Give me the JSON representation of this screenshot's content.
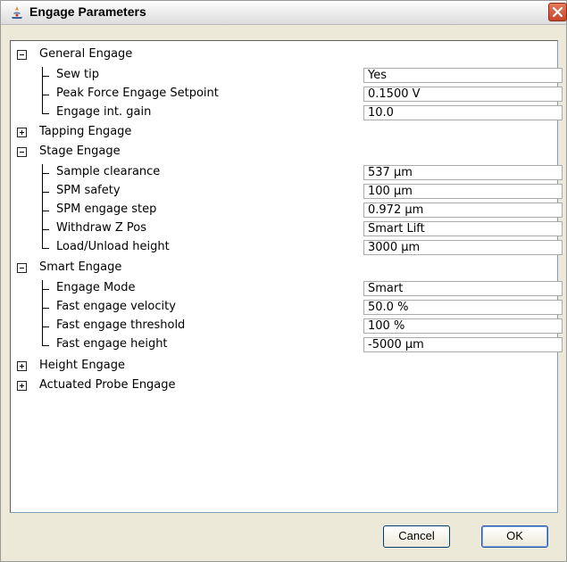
{
  "window": {
    "title": "Engage Parameters",
    "icon": "app-icon",
    "close_icon": "close-icon"
  },
  "groups": [
    {
      "label": "General Engage",
      "expanded": true,
      "items": [
        {
          "label": "Sew tip",
          "value": "Yes"
        },
        {
          "label": "Peak Force Engage Setpoint",
          "value": "0.1500 V"
        },
        {
          "label": "Engage int. gain",
          "value": "10.0"
        }
      ]
    },
    {
      "label": "Tapping Engage",
      "expanded": false,
      "items": []
    },
    {
      "label": "Stage Engage",
      "expanded": true,
      "items": [
        {
          "label": "Sample clearance",
          "value": "537 µm"
        },
        {
          "label": "SPM safety",
          "value": "100 µm"
        },
        {
          "label": "SPM engage step",
          "value": "0.972 µm"
        },
        {
          "label": "Withdraw Z Pos",
          "value": "Smart Lift"
        },
        {
          "label": "Load/Unload height",
          "value": "3000 µm"
        }
      ]
    },
    {
      "label": "Smart Engage",
      "expanded": true,
      "items": [
        {
          "label": "Engage Mode",
          "value": "Smart"
        },
        {
          "label": "Fast engage velocity",
          "value": "50.0 %"
        },
        {
          "label": "Fast engage threshold",
          "value": "100 %"
        },
        {
          "label": "Fast engage height",
          "value": "-5000 µm"
        }
      ]
    },
    {
      "label": "Height Engage",
      "expanded": false,
      "items": []
    },
    {
      "label": "Actuated Probe Engage",
      "expanded": false,
      "items": []
    }
  ],
  "footer": {
    "cancel_label": "Cancel",
    "ok_label": "OK"
  },
  "colors": {
    "panel": "#ece9d8",
    "close_button": "#d9573a",
    "value_border": "#ababab"
  }
}
